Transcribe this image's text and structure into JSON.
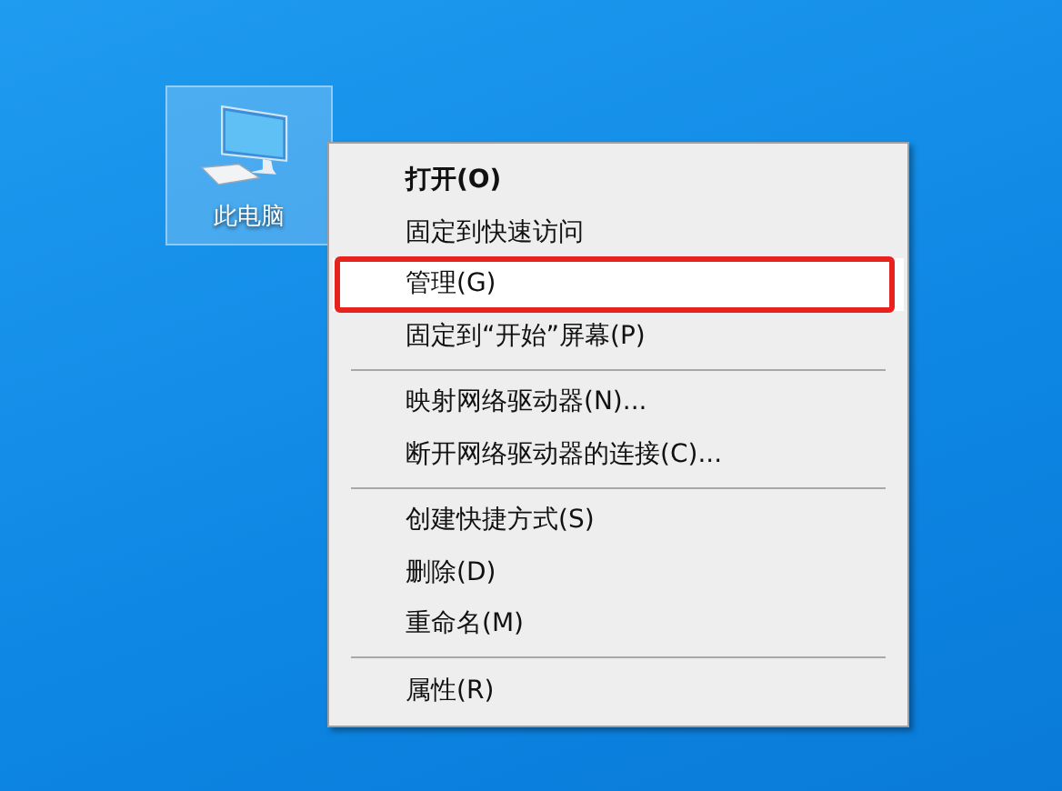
{
  "desktop_icons": [
    {
      "label": "此电脑",
      "selected": true
    }
  ],
  "context_menu": {
    "items": [
      {
        "kind": "item",
        "label": "打开(O)",
        "bold": true,
        "selected": false,
        "outlined": false
      },
      {
        "kind": "item",
        "label": "固定到快速访问",
        "bold": false,
        "selected": false,
        "outlined": false
      },
      {
        "kind": "item",
        "label": "管理(G)",
        "bold": false,
        "selected": true,
        "outlined": true
      },
      {
        "kind": "item",
        "label": "固定到“开始”屏幕(P)",
        "bold": false,
        "selected": false,
        "outlined": false
      },
      {
        "kind": "separator"
      },
      {
        "kind": "item",
        "label": "映射网络驱动器(N)...",
        "bold": false,
        "selected": false,
        "outlined": false
      },
      {
        "kind": "item",
        "label": "断开网络驱动器的连接(C)...",
        "bold": false,
        "selected": false,
        "outlined": false
      },
      {
        "kind": "separator"
      },
      {
        "kind": "item",
        "label": "创建快捷方式(S)",
        "bold": false,
        "selected": false,
        "outlined": false
      },
      {
        "kind": "item",
        "label": "删除(D)",
        "bold": false,
        "selected": false,
        "outlined": false
      },
      {
        "kind": "item",
        "label": "重命名(M)",
        "bold": false,
        "selected": false,
        "outlined": false
      },
      {
        "kind": "separator"
      },
      {
        "kind": "item",
        "label": "属性(R)",
        "bold": false,
        "selected": false,
        "outlined": false
      }
    ]
  }
}
